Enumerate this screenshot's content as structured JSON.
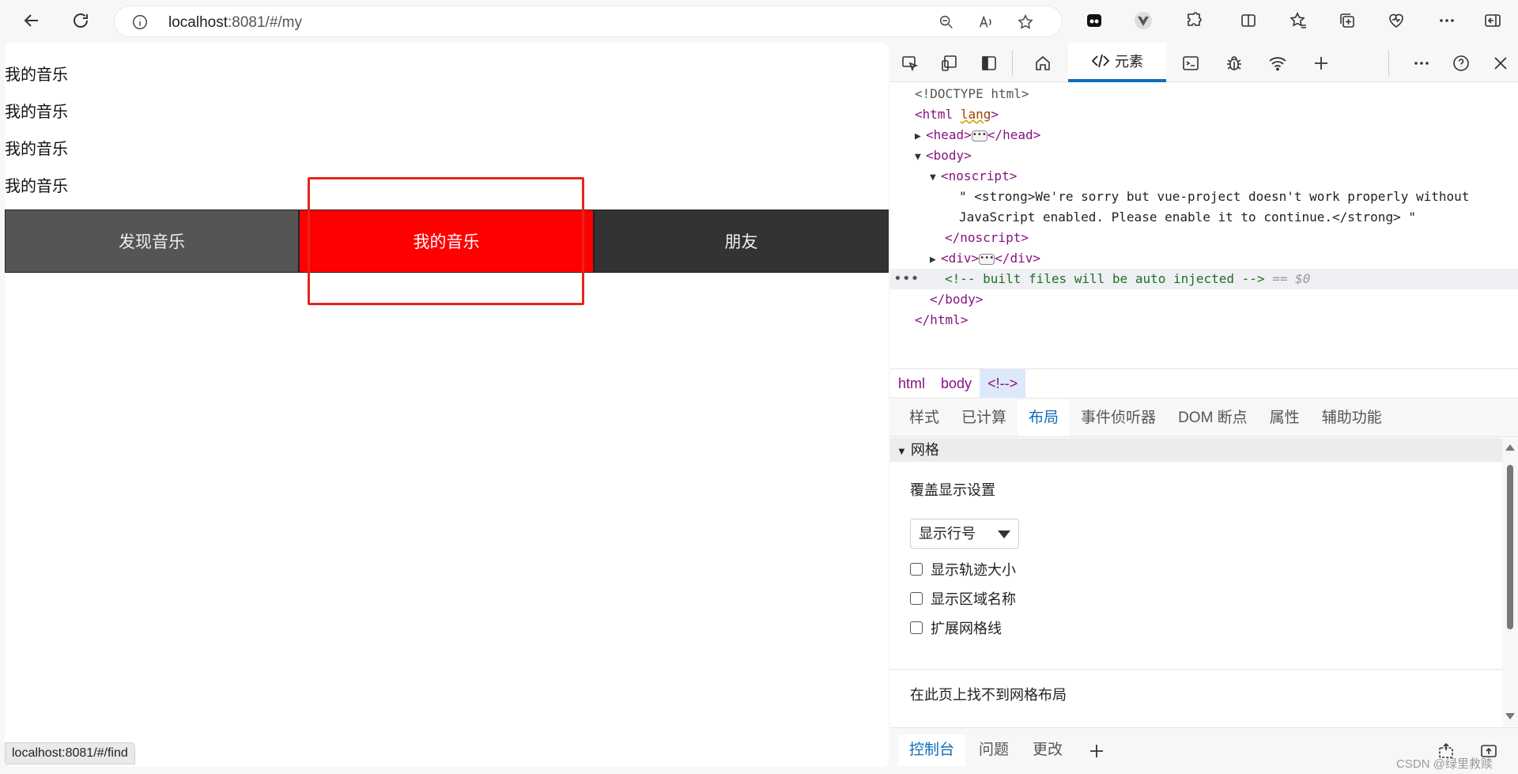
{
  "browser": {
    "url_host": "localhost",
    "url_path": ":8081/#/my"
  },
  "page": {
    "lines": [
      "我的音乐",
      "我的音乐",
      "我的音乐",
      "我的音乐"
    ],
    "nav": [
      "发现音乐",
      "我的音乐",
      "朋友"
    ],
    "status_url": "localhost:8081/#/find"
  },
  "devtools": {
    "active_tab": "元素",
    "dom": {
      "doctype": "<!DOCTYPE html>",
      "html_open": "<html",
      "html_attr": "lang",
      "head_open": "<head>",
      "head_close": "</head>",
      "body_open": "<body>",
      "noscript_open": "<noscript>",
      "text_line1": "\" <strong>We're sorry but vue-project doesn't work properly without",
      "text_line2": "JavaScript enabled. Please enable it to continue.</strong> \"",
      "noscript_close": "</noscript>",
      "div_open": "<div>",
      "div_close": "</div>",
      "comment": "<!-- built files will be auto injected -->",
      "dollar": "== $0",
      "body_close": "</body>",
      "html_close": "</html>"
    },
    "breadcrumbs": [
      "html",
      "body",
      "<!-->"
    ],
    "subtabs": [
      "样式",
      "已计算",
      "布局",
      "事件侦听器",
      "DOM 断点",
      "属性",
      "辅助功能"
    ],
    "layout": {
      "section": "网格",
      "overlay_title": "覆盖显示设置",
      "select_value": "显示行号",
      "checkboxes": [
        "显示轨迹大小",
        "显示区域名称",
        "扩展网格线"
      ],
      "empty_msg": "在此页上找不到网格布局"
    },
    "drawer_tabs": [
      "控制台",
      "问题",
      "更改"
    ],
    "watermark": "CSDN @绿里救赎"
  }
}
